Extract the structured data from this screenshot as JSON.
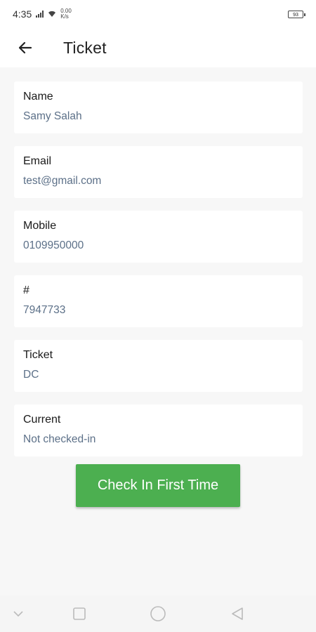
{
  "status_bar": {
    "time": "4:35",
    "net_speed_top": "0.00",
    "net_speed_bottom": "K/s",
    "battery": "93"
  },
  "app_bar": {
    "title": "Ticket"
  },
  "fields": [
    {
      "label": "Name",
      "value": "Samy Salah"
    },
    {
      "label": "Email",
      "value": "test@gmail.com"
    },
    {
      "label": "Mobile",
      "value": "0109950000"
    },
    {
      "label": "#",
      "value": "7947733"
    },
    {
      "label": "Ticket",
      "value": "DC"
    },
    {
      "label": "Current",
      "value": "Not checked-in"
    }
  ],
  "actions": {
    "check_in_label": "Check In First Time"
  },
  "colors": {
    "accent": "#4caf50",
    "value_text": "#5c7088"
  }
}
